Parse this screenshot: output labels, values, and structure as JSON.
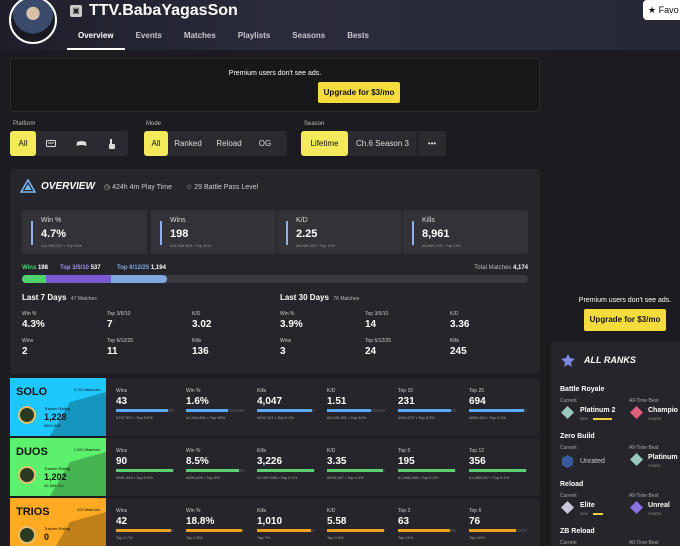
{
  "header": {
    "username": "TTV.BabaYagasSon",
    "favorite_label": "Favo",
    "nav": [
      "Overview",
      "Events",
      "Matches",
      "Playlists",
      "Seasons",
      "Bests"
    ]
  },
  "ad_top": {
    "text": "Premium users don't see ads.",
    "button": "Upgrade for $3/mo"
  },
  "filters": {
    "platform_label": "Platform",
    "platform_all": "All",
    "mode_label": "Mode",
    "modes": [
      "All",
      "Ranked",
      "Reload",
      "OG"
    ],
    "season_label": "Season",
    "seasons": [
      "Lifetime",
      "Ch.6 Season 3"
    ],
    "more": "•••"
  },
  "overview": {
    "title": "OVERVIEW",
    "playtime": "424h 4m Play Time",
    "battle_pass": "29 Battle Pass Level",
    "cards": [
      {
        "label": "Win %",
        "value": "4.7%",
        "sub": "#11,553,537 • Top 44%"
      },
      {
        "label": "Wins",
        "value": "198",
        "sub": "#11,536,954 • Top 32%"
      },
      {
        "label": "K/D",
        "value": "2.25",
        "sub": "#6,086,331 • Top 19%"
      },
      {
        "label": "Kills",
        "value": "8,961",
        "sub": "#8,669,105 • Top 24%"
      }
    ],
    "progress": {
      "wins_label": "Wins",
      "wins_value": "198",
      "top5_label": "Top 3/5/10",
      "top5_value": "537",
      "top6_label": "Top 6/12/25",
      "top6_value": "1,194",
      "total_label": "Total Matches",
      "total_value": "4,174",
      "wins_fraction": 0.047,
      "top5_fraction": 0.176,
      "top6_fraction": 0.286
    },
    "last7": {
      "title": "Last 7 Days",
      "matches": "47 Matches",
      "stats": [
        {
          "label": "Win %",
          "value": "4.3%"
        },
        {
          "label": "Top 3/5/10",
          "value": "7"
        },
        {
          "label": "K/D",
          "value": "3.02"
        },
        {
          "label": "Wins",
          "value": "2"
        },
        {
          "label": "Top 6/12/25",
          "value": "11"
        },
        {
          "label": "Kills",
          "value": "136"
        }
      ]
    },
    "last30": {
      "title": "Last 30 Days",
      "matches": "76 Matches",
      "stats": [
        {
          "label": "Win %",
          "value": "3.9%"
        },
        {
          "label": "Top 3/5/10",
          "value": "14"
        },
        {
          "label": "K/D",
          "value": "3.36"
        },
        {
          "label": "Wins",
          "value": "3"
        },
        {
          "label": "Top 6/12/25",
          "value": "24"
        },
        {
          "label": "Kills",
          "value": "245"
        }
      ]
    }
  },
  "playlists": [
    {
      "name": "SOLO",
      "matches": "2,723 Matches",
      "color": "#1ec8ff",
      "tr_label": "Tracker Rating",
      "tr_value": "1,228",
      "tr_sub": "#824,948",
      "bar_color": "#5aa8ff",
      "stats": [
        {
          "label": "Wins",
          "value": "43",
          "sub": "#727,937 • Top 9.0%",
          "fill": 0.9
        },
        {
          "label": "Win %",
          "value": "1.6%",
          "sub": "#1,944,801 • Top 28%",
          "fill": 0.72
        },
        {
          "label": "Kills",
          "value": "4,047",
          "sub": "#522,121 • Top 5.1%",
          "fill": 0.95
        },
        {
          "label": "K/D",
          "value": "1.51",
          "sub": "#2,145,391 • Top 24%",
          "fill": 0.76
        },
        {
          "label": "Top 10",
          "value": "231",
          "sub": "#944,237 • Top 8.2%",
          "fill": 0.92
        },
        {
          "label": "Top 25",
          "value": "694",
          "sub": "#889,423 • Top 5.1%",
          "fill": 0.95
        }
      ]
    },
    {
      "name": "DUOS",
      "matches": "1,093 Matches",
      "color": "#5cf06c",
      "tr_label": "Tracker Rating",
      "tr_value": "1,202",
      "tr_sub": "#2,584,112",
      "bar_color": "#5cd070",
      "stats": [
        {
          "label": "Wins",
          "value": "90",
          "sub": "#981,049 • Top 0.3%",
          "fill": 0.99
        },
        {
          "label": "Win %",
          "value": "8.5%",
          "sub": "#455,204 • Top 8%",
          "fill": 0.92
        },
        {
          "label": "Kills",
          "value": "3,226",
          "sub": "#1,067,669 • Top 0.1%",
          "fill": 0.99
        },
        {
          "label": "K/D",
          "value": "3.35",
          "sub": "#578,187 • Top 2.4%",
          "fill": 0.97
        },
        {
          "label": "Top 5",
          "value": "195",
          "sub": "#1,566,988 • Top 0.2%",
          "fill": 0.99
        },
        {
          "label": "Top 12",
          "value": "356",
          "sub": "#1,665,207 • Top 0.1%",
          "fill": 0.99
        }
      ]
    },
    {
      "name": "TRIOS",
      "matches": "223 Matches",
      "color": "#ffaa22",
      "tr_label": "Tracker Rating",
      "tr_value": "0",
      "tr_sub": "",
      "bar_color": "#f0a020",
      "stats": [
        {
          "label": "Wins",
          "value": "42",
          "sub": "Top 4.7%",
          "fill": 0.95
        },
        {
          "label": "Win %",
          "value": "18.8%",
          "sub": "Top 2.8%",
          "fill": 0.97
        },
        {
          "label": "Kills",
          "value": "1,010",
          "sub": "Top 7%",
          "fill": 0.93
        },
        {
          "label": "K/D",
          "value": "5.58",
          "sub": "Top 0.6%",
          "fill": 0.99
        },
        {
          "label": "Top 3",
          "value": "63",
          "sub": "Top 11%",
          "fill": 0.89
        },
        {
          "label": "Top 6",
          "value": "76",
          "sub": "Top 19%",
          "fill": 0.81
        }
      ]
    }
  ],
  "right_ad": {
    "text": "Premium users don't see ads.",
    "button": "Upgrade for $3/mo"
  },
  "ranks": {
    "title": "ALL RANKS",
    "modes": [
      {
        "name": "Battle Royale",
        "current_label": "Current",
        "current": "Platinum 2",
        "current_sub": "94%",
        "best_label": "All-Time Best",
        "best": "Champio",
        "best_sub": "CH4S5"
      },
      {
        "name": "Zero Build",
        "current_label": "Current",
        "current": "Unrated",
        "current_sub": "",
        "best_label": "All-Time Best",
        "best": "Platinum",
        "best_sub": "CH5S1"
      },
      {
        "name": "Reload",
        "current_label": "Current",
        "current": "Elite",
        "current_sub": "49%",
        "best_label": "All-Time Best",
        "best": "Unreal",
        "best_sub": "CH5S5"
      },
      {
        "name": "ZB Reload",
        "current_label": "Current",
        "current": "",
        "current_sub": "",
        "best_label": "All-Time Best",
        "best": "",
        "best_sub": ""
      }
    ],
    "current_fill": 0.94,
    "reload_fill": 0.49
  }
}
